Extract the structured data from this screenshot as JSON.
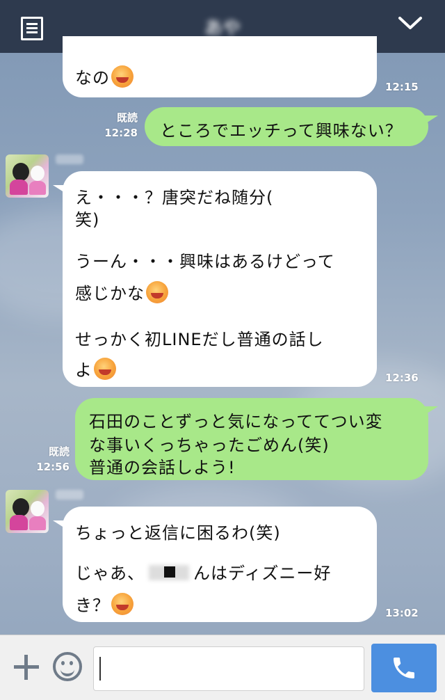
{
  "header": {
    "title": "あや",
    "menu_icon": "menu-icon",
    "collapse_icon": "chevron-down-icon"
  },
  "messages": {
    "m1": {
      "line1": "なの",
      "time": "12:15"
    },
    "m2": {
      "read": "既読",
      "read_time": "12:28",
      "line1": "ところでエッチって興味ない？"
    },
    "m3": {
      "line1": "え・・・？唐突だね随分(",
      "line2": "笑)",
      "line3": "うーん・・・興味はあるけどって",
      "line4": "感じかな",
      "line5": "せっかく初LINEだし普通の話し",
      "line6": "よ",
      "time": "12:36"
    },
    "m4": {
      "read": "既読",
      "read_time": "12:56",
      "line1": "石田のことずっと気になっててつい変",
      "line2": "な事いくっちゃったごめん(笑)",
      "line3": "普通の会話しよう!"
    },
    "m5": {
      "line1": "ちょっと返信に困るわ(笑)",
      "line2a": "じゃあ、",
      "line2b": "んはディズニー好",
      "line3": "き？",
      "time": "13:02"
    }
  },
  "input": {
    "placeholder": "",
    "plus_icon": "plus-icon",
    "emoji_icon": "emoji-icon",
    "call_icon": "phone-icon"
  },
  "colors": {
    "header": "#2e3a4e",
    "sent_bubble": "#a8e889",
    "received_bubble": "#ffffff",
    "call_button": "#4c8fe0"
  }
}
